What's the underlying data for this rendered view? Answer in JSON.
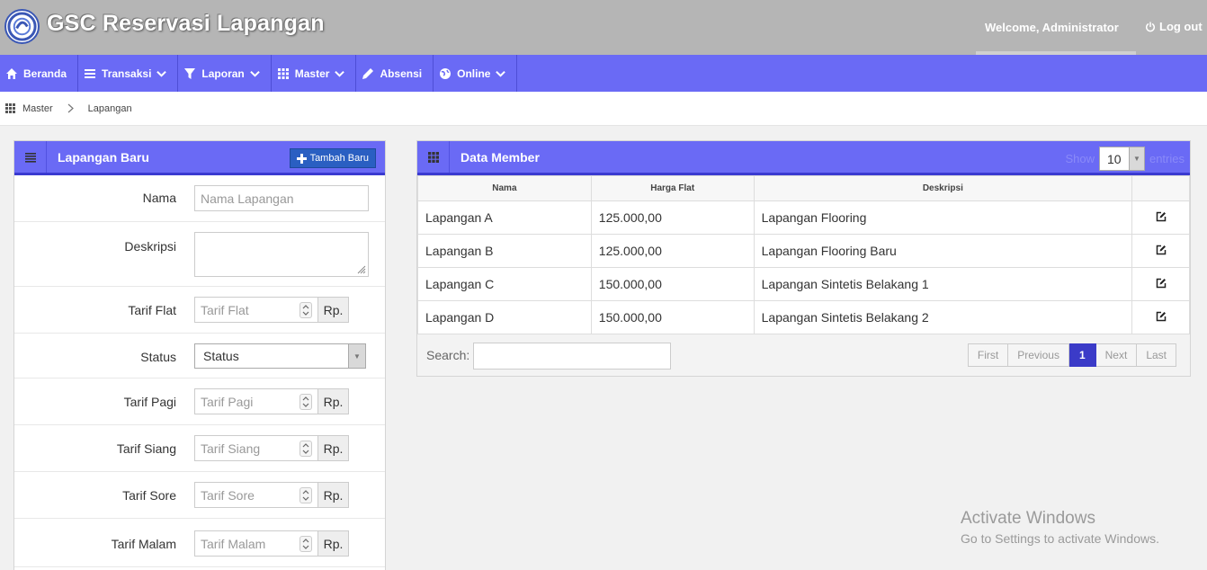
{
  "header": {
    "title": "GSC Reservasi Lapangan",
    "welcome": "Welcome, Administrator",
    "logout_label": "Log out"
  },
  "nav": [
    {
      "label": "Beranda",
      "icon": "home-icon",
      "dropdown": false
    },
    {
      "label": "Transaksi",
      "icon": "list-icon",
      "dropdown": true
    },
    {
      "label": "Laporan",
      "icon": "filter-icon",
      "dropdown": true
    },
    {
      "label": "Master",
      "icon": "grid-icon",
      "dropdown": true
    },
    {
      "label": "Absensi",
      "icon": "pencil-icon",
      "dropdown": false
    },
    {
      "label": "Online",
      "icon": "globe-icon",
      "dropdown": true
    }
  ],
  "breadcrumb": {
    "items": [
      "Master",
      "Lapangan"
    ]
  },
  "form": {
    "title": "Lapangan Baru",
    "add_button": "Tambah Baru",
    "fields": {
      "nama": {
        "label": "Nama",
        "placeholder": "Nama Lapangan"
      },
      "deskripsi": {
        "label": "Deskripsi"
      },
      "tarif_flat": {
        "label": "Tarif Flat",
        "placeholder": "Tarif Flat",
        "addon": "Rp."
      },
      "status": {
        "label": "Status",
        "value": "Status"
      },
      "tarif_pagi": {
        "label": "Tarif Pagi",
        "placeholder": "Tarif Pagi",
        "addon": "Rp."
      },
      "tarif_siang": {
        "label": "Tarif Siang",
        "placeholder": "Tarif Siang",
        "addon": "Rp."
      },
      "tarif_sore": {
        "label": "Tarif Sore",
        "placeholder": "Tarif Sore",
        "addon": "Rp."
      },
      "tarif_malam": {
        "label": "Tarif Malam",
        "placeholder": "Tarif Malam",
        "addon": "Rp."
      }
    }
  },
  "table": {
    "title": "Data Member",
    "show_label": "Show",
    "show_value": "10",
    "entries_label": "entries",
    "columns": [
      "Nama",
      "Harga Flat",
      "Deskripsi",
      ""
    ],
    "rows": [
      {
        "nama": "Lapangan A",
        "harga": "125.000,00",
        "deskripsi": "Lapangan Flooring"
      },
      {
        "nama": "Lapangan B",
        "harga": "125.000,00",
        "deskripsi": "Lapangan Flooring Baru"
      },
      {
        "nama": "Lapangan C",
        "harga": "150.000,00",
        "deskripsi": "Lapangan Sintetis Belakang 1"
      },
      {
        "nama": "Lapangan D",
        "harga": "150.000,00",
        "deskripsi": "Lapangan Sintetis Belakang 2"
      }
    ],
    "search_label": "Search:",
    "pager": {
      "first": "First",
      "previous": "Previous",
      "current": "1",
      "next": "Next",
      "last": "Last"
    }
  },
  "watermark": {
    "line1": "Activate Windows",
    "line2": "Go to Settings to activate Windows."
  },
  "colors": {
    "nav": "#6a6af5",
    "header": "#b5b5b5",
    "accent": "#3b3bc8",
    "button": "#2a5fc2"
  }
}
